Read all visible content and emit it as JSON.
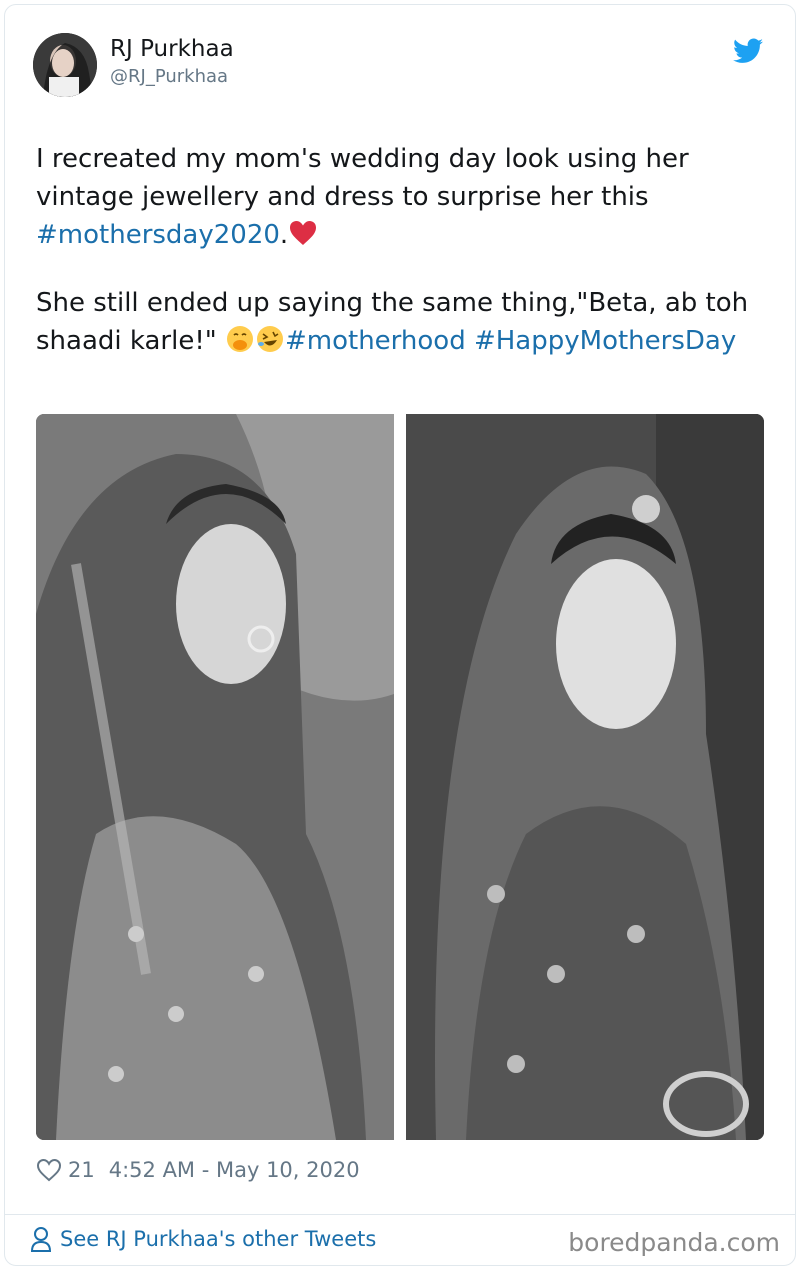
{
  "user": {
    "name": "RJ Purkhaa",
    "handle": "@RJ_Purkhaa"
  },
  "tweet": {
    "line1": "I recreated my mom's wedding day look using her vintage jewellery and dress to surprise her this ",
    "hashtag1": "#mothersday2020",
    "after_hashtag1": ".",
    "emoji1": "red-heart-emoji",
    "line2": "She still ended up saying the same thing,\"Beta, ab toh shaadi karle!\" ",
    "emoji2": "face-with-hand-over-mouth-emoji",
    "emoji3": "rolling-on-floor-laughing-emoji",
    "hashtag2": "#motherhood",
    "hashtag3": "#HappyMothersDay"
  },
  "meta": {
    "likes": "21",
    "timestamp": "4:52 AM - May 10, 2020"
  },
  "footer": {
    "other_tweets": "See RJ Purkhaa's other Tweets",
    "watermark": "boredpanda.com"
  },
  "colors": {
    "link": "#1b6fab",
    "twitter_blue": "#1da1f2",
    "heart_red": "#dd2e44",
    "muted": "#657786"
  },
  "icons": {
    "bird": "twitter-bird-icon",
    "like": "heart-outline-icon",
    "person": "person-icon"
  }
}
